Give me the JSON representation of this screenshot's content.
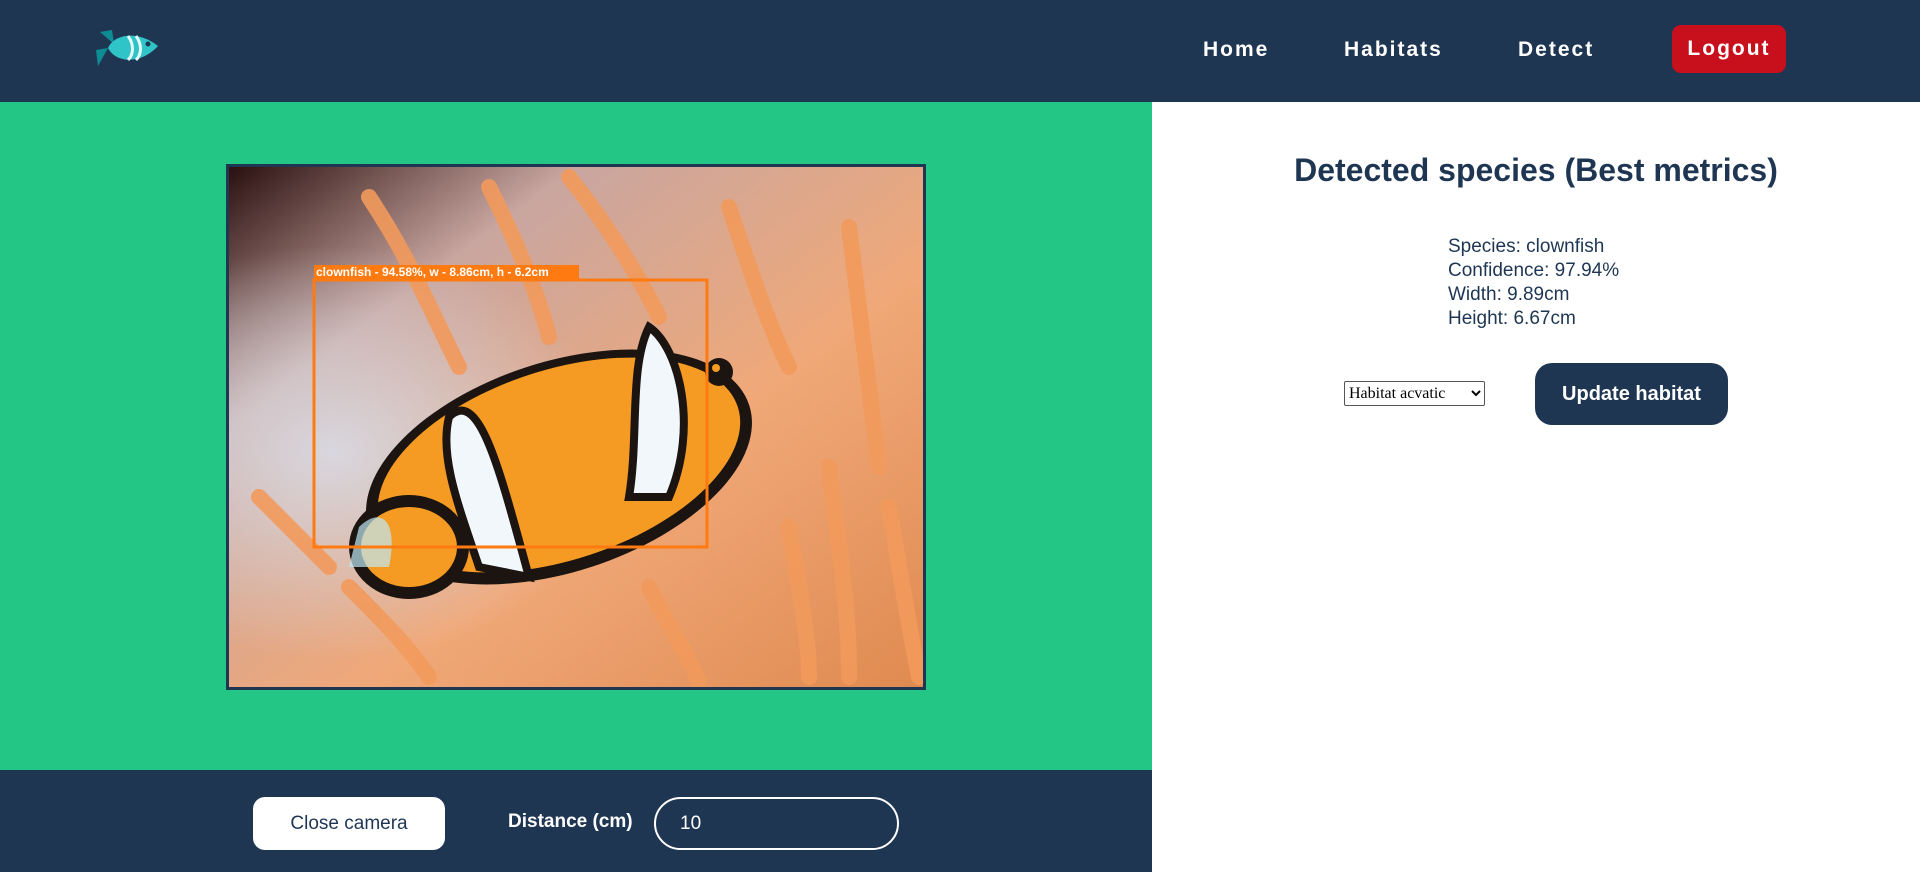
{
  "nav": {
    "logo_icon": "fish-icon",
    "links": [
      {
        "label": "Home"
      },
      {
        "label": "Habitats"
      },
      {
        "label": "Detect"
      }
    ],
    "logout_label": "Logout"
  },
  "camera": {
    "detection_label": "clownfish - 94.58%, w - 8.86cm, h - 6.2cm",
    "close_label": "Close camera",
    "distance_label": "Distance (cm)",
    "distance_value": "10"
  },
  "results": {
    "title": "Detected species (Best metrics)",
    "species": "Species: clownfish",
    "confidence": "Confidence: 97.94%",
    "width": "Width: 9.89cm",
    "height": "Height: 6.67cm",
    "habitat_selected": "Habitat acvatic",
    "update_label": "Update habitat"
  },
  "colors": {
    "navy": "#1f3653",
    "green": "#24c686",
    "logout_red": "#c8101c",
    "box_orange": "#ff7a10"
  }
}
